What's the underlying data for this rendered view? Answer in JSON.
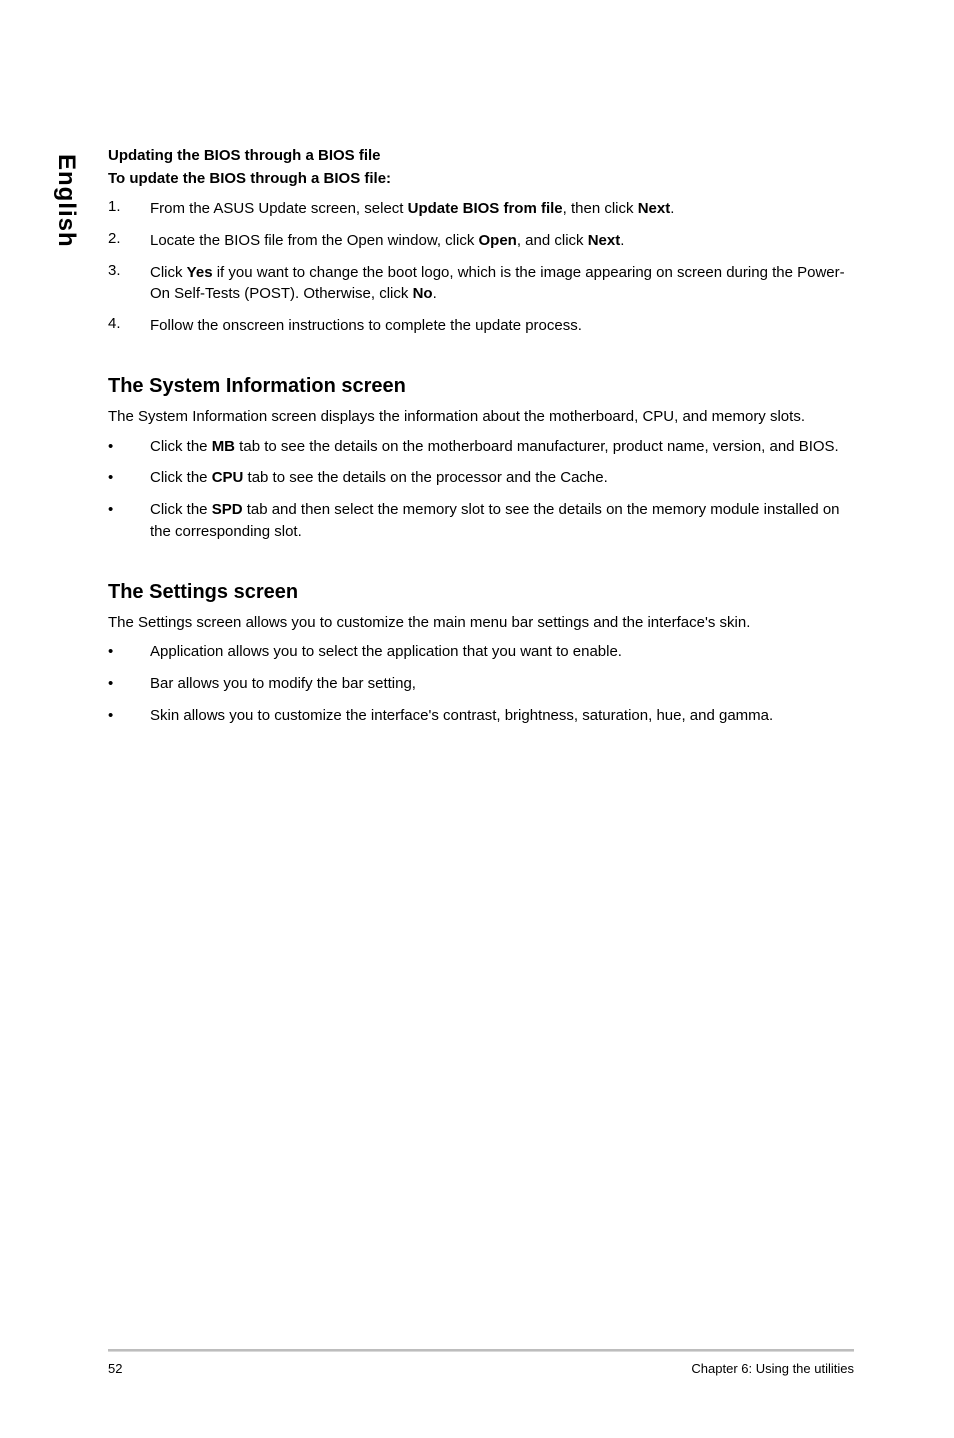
{
  "side_label": "English",
  "sec1": {
    "h4a": "Updating the BIOS through a BIOS file",
    "h4b": "To update the BIOS through a BIOS file:",
    "steps": [
      {
        "num": "1.",
        "pre": "From the ASUS Update screen, select ",
        "b1": "Update BIOS from file",
        "mid": ", then click ",
        "b2": "Next",
        "post": "."
      },
      {
        "num": "2.",
        "pre": "Locate the BIOS file from the Open window, click ",
        "b1": "Open",
        "mid": ", and click ",
        "b2": "Next",
        "post": "."
      },
      {
        "num": "3.",
        "pre": "Click ",
        "b1": "Yes",
        "mid": " if you want to change the boot logo, which is the image appearing on screen during the Power-On Self-Tests (POST). Otherwise, click ",
        "b2": "No",
        "post": "."
      },
      {
        "num": "4.",
        "pre": "Follow the onscreen instructions to complete the update process.",
        "b1": "",
        "mid": "",
        "b2": "",
        "post": ""
      }
    ]
  },
  "sec2": {
    "h2": "The System Information screen",
    "intro": "The System Information screen displays the information about the motherboard, CPU, and memory slots.",
    "bullets": [
      {
        "pre": "Click the ",
        "b": "MB",
        "post": " tab to see the details on the motherboard manufacturer, product name, version, and BIOS."
      },
      {
        "pre": "Click the ",
        "b": "CPU",
        "post": " tab to see the details on the processor and the Cache."
      },
      {
        "pre": "Click the ",
        "b": "SPD",
        "post": " tab and then select the memory slot to see the details on the memory module installed on the corresponding slot."
      }
    ]
  },
  "sec3": {
    "h2": "The Settings screen",
    "intro": "The Settings screen allows you to customize the main menu bar settings and the interface's skin.",
    "bullets": [
      "Application allows you to select the application that you want to enable.",
      "Bar allows you to modify the bar setting,",
      "Skin allows you to customize the interface's contrast, brightness, saturation, hue, and gamma."
    ]
  },
  "footer": {
    "page": "52",
    "chapter": "Chapter 6: Using the utilities"
  }
}
